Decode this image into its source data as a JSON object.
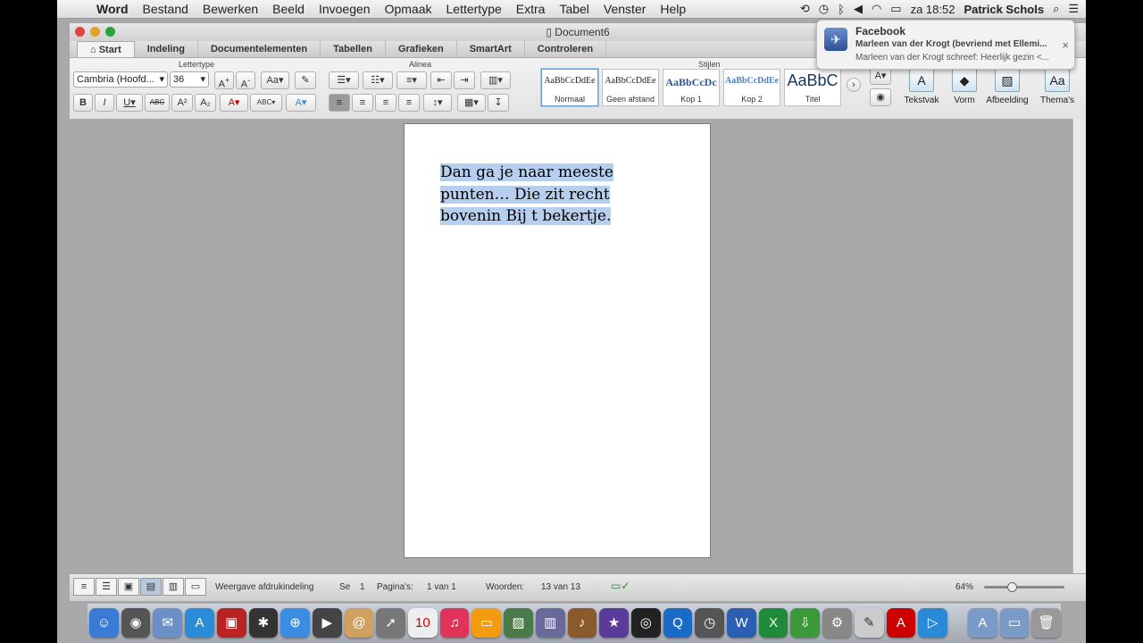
{
  "menubar": {
    "app": "Word",
    "items": [
      "Bestand",
      "Bewerken",
      "Beeld",
      "Invoegen",
      "Opmaak",
      "Lettertype",
      "Extra",
      "Tabel",
      "Venster",
      "Help"
    ],
    "clock": "za 18:52",
    "user": "Patrick Schols"
  },
  "window": {
    "title": "Document6",
    "tabs": [
      "Start",
      "Indeling",
      "Documentelementen",
      "Tabellen",
      "Grafieken",
      "SmartArt",
      "Controleren"
    ]
  },
  "ribbon": {
    "group_lettertype": "Lettertype",
    "group_alinea": "Alinea",
    "group_stijlen": "Stijlen",
    "font_name": "Cambria (Hoofd...",
    "font_size": "36",
    "styles": [
      {
        "sample": "AaBbCcDdEe",
        "name": "Normaal"
      },
      {
        "sample": "AaBbCcDdEe",
        "name": "Geen afstand"
      },
      {
        "sample": "AaBbCcDc",
        "name": "Kop 1"
      },
      {
        "sample": "AaBbCcDdEe",
        "name": "Kop 2"
      },
      {
        "sample": "AaBbC",
        "name": "Titel"
      }
    ],
    "insert_buttons": [
      "Tekstvak",
      "Vorm",
      "Afbeelding",
      "Thema's"
    ]
  },
  "document": {
    "text": "Dan ga je naar meeste punten… Die zit recht bovenin Bij t bekertje."
  },
  "statusbar": {
    "view": "Weergave afdrukindeling",
    "se_label": "Se",
    "se_value": "1",
    "page_label": "Pagina's:",
    "page_value": "1 van 1",
    "words_label": "Woorden:",
    "words_value": "13 van 13",
    "zoom": "64%"
  },
  "notification": {
    "app": "Facebook",
    "line1": "Marleen van der Krogt (bevriend met Ellemi...",
    "line2": "Marleen van der Krogt schreef: Heerlijk gezin <..."
  },
  "colors": {
    "selection": "#b7cfee",
    "accent": "#6a9fd6"
  }
}
